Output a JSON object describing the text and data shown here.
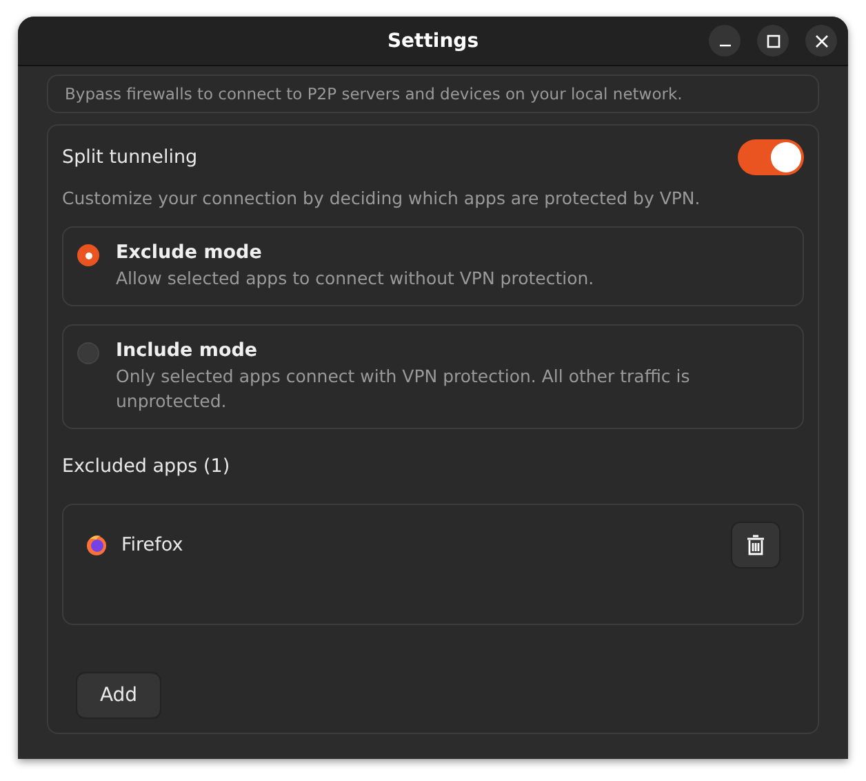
{
  "window": {
    "title": "Settings"
  },
  "top_card": {
    "description": "Bypass firewalls to connect to P2P servers and devices on your local network."
  },
  "split_tunneling": {
    "label": "Split tunneling",
    "on": true,
    "description": "Customize your connection by deciding which apps are protected by VPN.",
    "modes": [
      {
        "title": "Exclude mode",
        "description": "Allow selected apps to connect without VPN protection.",
        "selected": true
      },
      {
        "title": "Include mode",
        "description": "Only selected apps connect with VPN protection. All other traffic is unprotected.",
        "selected": false
      }
    ],
    "apps_heading": "Excluded apps (1)",
    "apps": [
      {
        "name": "Firefox"
      }
    ],
    "add_button": "Add"
  }
}
